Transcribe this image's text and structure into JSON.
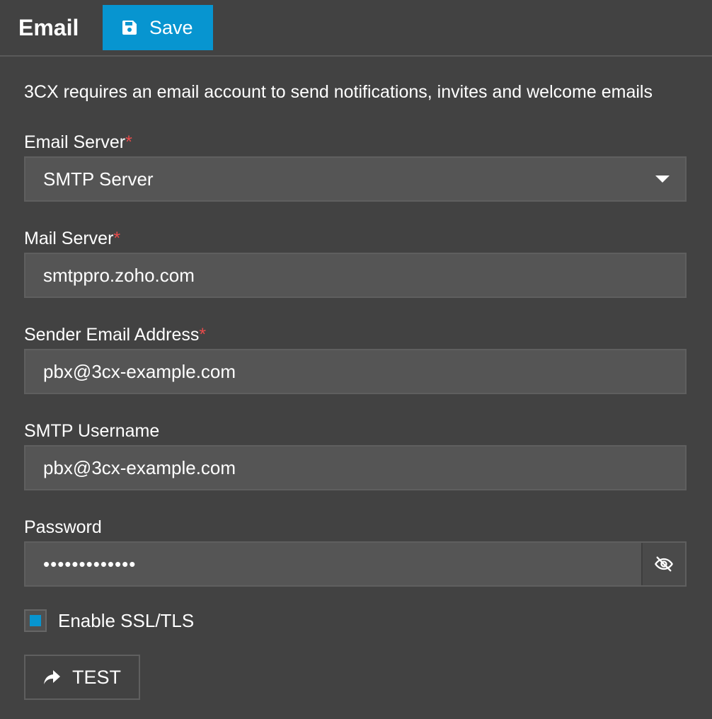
{
  "header": {
    "title": "Email",
    "save_label": "Save"
  },
  "intro": "3CX requires an email account to send notifications, invites and welcome emails",
  "fields": {
    "email_server": {
      "label": "Email Server",
      "required": "*",
      "value": "SMTP Server"
    },
    "mail_server": {
      "label": "Mail Server",
      "required": "*",
      "value": "smtppro.zoho.com"
    },
    "sender_email": {
      "label": "Sender Email Address",
      "required": "*",
      "value": "pbx@3cx-example.com"
    },
    "smtp_username": {
      "label": "SMTP Username",
      "value": "pbx@3cx-example.com"
    },
    "password": {
      "label": "Password",
      "value": "•••••••••••••"
    }
  },
  "ssl": {
    "label": "Enable SSL/TLS",
    "checked": true
  },
  "test_label": "TEST",
  "colors": {
    "background": "#424242",
    "accent": "#0795d0",
    "required": "#e94b4b",
    "field_bg": "#555555"
  },
  "icons": {
    "save": "floppy-disk-icon",
    "eye": "eye-slash-icon",
    "test": "share-arrow-icon",
    "dropdown": "caret-down-icon"
  }
}
